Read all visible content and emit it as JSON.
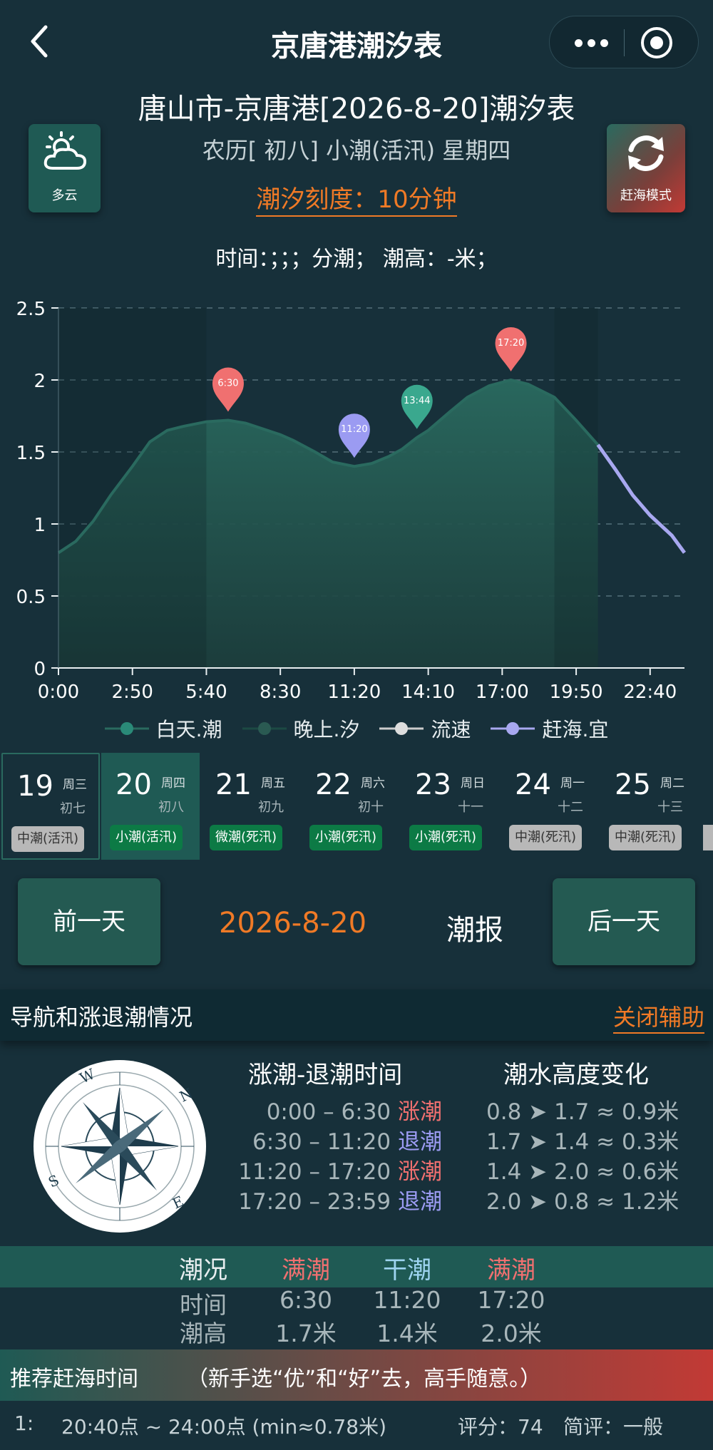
{
  "nav": {
    "title": "京唐港潮汐表"
  },
  "header": {
    "title": "唐山市-京唐港[2026-8-20]潮汐表",
    "subtitle": "农历[ 初八] 小潮(活汛) 星期四",
    "scale": "潮汐刻度：10分钟",
    "readout": "时间：；；；分潮；  潮高：-米；"
  },
  "weather": {
    "label": "多云",
    "icon": "cloud-sun-icon"
  },
  "sea_mode": {
    "label": "赶海模式",
    "icon": "refresh-icon"
  },
  "chart_data": {
    "type": "area",
    "x": [
      "0:00",
      "0:40",
      "1:20",
      "2:00",
      "2:50",
      "3:30",
      "4:10",
      "4:50",
      "5:40",
      "6:30",
      "7:10",
      "8:00",
      "8:30",
      "9:00",
      "9:50",
      "10:30",
      "11:20",
      "12:00",
      "12:40",
      "13:10",
      "13:44",
      "14:10",
      "15:00",
      "15:40",
      "16:30",
      "17:20",
      "18:00",
      "19:00",
      "19:50",
      "20:40",
      "21:20",
      "22:00",
      "22:40",
      "23:30",
      "23:59"
    ],
    "series": [
      {
        "name": "白天.潮",
        "values": [
          0.8,
          0.88,
          1.02,
          1.2,
          1.4,
          1.57,
          1.65,
          1.68,
          1.71,
          1.72,
          1.7,
          1.65,
          1.62,
          1.58,
          1.5,
          1.43,
          1.4,
          1.42,
          1.47,
          1.52,
          1.6,
          1.65,
          1.78,
          1.88,
          1.96,
          2.0,
          1.97,
          1.88,
          1.72,
          1.55,
          1.38,
          1.2,
          1.06,
          0.92,
          0.8
        ]
      }
    ],
    "segments": {
      "night_end": "5:40",
      "night_start": "19:00",
      "sea_start": "20:40"
    },
    "markers": [
      {
        "label": "6:30",
        "x": "6:30",
        "y": 1.72,
        "color": "#f07070"
      },
      {
        "label": "11:20",
        "x": "11:20",
        "y": 1.4,
        "color": "#9b9bf2"
      },
      {
        "label": "13:44",
        "x": "13:44",
        "y": 1.6,
        "color": "#3aa88e"
      },
      {
        "label": "17:20",
        "x": "17:20",
        "y": 2.0,
        "color": "#f07070"
      }
    ],
    "xticks": [
      "0:00",
      "2:50",
      "5:40",
      "8:30",
      "11:20",
      "14:10",
      "17:00",
      "19:50",
      "22:40"
    ],
    "yticks": [
      "0",
      "0.5",
      "1",
      "1.5",
      "2",
      "2.5"
    ],
    "ylim": [
      0,
      2.5
    ],
    "grid": true,
    "legend": [
      "白天.潮",
      "晚上.汐",
      "流速",
      "赶海.宜"
    ],
    "legend_placement": "bottom",
    "colors": {
      "day": "#2a6a5f",
      "night": "#1c4a44",
      "flow": "#cccccc",
      "sea": "#a8a8f0"
    }
  },
  "days": [
    {
      "num": "19",
      "week": "周三",
      "lunar": "初七",
      "tide": "中潮(活汛)",
      "badge": "grey"
    },
    {
      "num": "20",
      "week": "周四",
      "lunar": "初八",
      "tide": "小潮(活汛)",
      "badge": "green"
    },
    {
      "num": "21",
      "week": "周五",
      "lunar": "初九",
      "tide": "微潮(死汛)",
      "badge": "green"
    },
    {
      "num": "22",
      "week": "周六",
      "lunar": "初十",
      "tide": "小潮(死汛)",
      "badge": "green"
    },
    {
      "num": "23",
      "week": "周日",
      "lunar": "十一",
      "tide": "小潮(死汛)",
      "badge": "green"
    },
    {
      "num": "24",
      "week": "周一",
      "lunar": "十二",
      "tide": "中潮(死汛)",
      "badge": "grey"
    },
    {
      "num": "25",
      "week": "周二",
      "lunar": "十三",
      "tide": "中潮(死汛)",
      "badge": "grey"
    }
  ],
  "controls": {
    "prev": "前一天",
    "date": "2026-8-20",
    "report": "潮报",
    "next": "后一天"
  },
  "section": {
    "title": "导航和涨退潮情况",
    "close": "关闭辅助"
  },
  "tide_times": {
    "header": "涨潮-退潮时间",
    "rows": [
      {
        "range": "0:00 – 6:30",
        "state": "涨潮",
        "color": "red"
      },
      {
        "range": "6:30 – 11:20",
        "state": "退潮",
        "color": "blue"
      },
      {
        "range": "11:20 – 17:20",
        "state": "涨潮",
        "color": "red"
      },
      {
        "range": "17:20 – 23:59",
        "state": "退潮",
        "color": "blue"
      }
    ]
  },
  "height_change": {
    "header": "潮水高度变化",
    "rows": [
      "0.8 ➤ 1.7 ≈ 0.9米",
      "1.7 ➤ 1.4 ≈ 0.3米",
      "1.4 ➤ 2.0 ≈ 0.6米",
      "2.0 ➤ 0.8 ≈ 1.2米"
    ]
  },
  "status": {
    "header": [
      "潮况",
      "满潮",
      "干潮",
      "满潮"
    ],
    "time_label": "时间",
    "times": [
      "6:30",
      "11:20",
      "17:20"
    ],
    "height_label": "潮高",
    "heights": [
      "1.7米",
      "1.4米",
      "2.0米"
    ]
  },
  "recommend": {
    "title": "推荐赶海时间",
    "hint": "（新手选“优”和“好”去，高手随意。）",
    "items": [
      {
        "idx": "1:",
        "time": "20:40点 ~ 24:00点 (min≈0.78米)",
        "score": "评分：74",
        "review": "简评：一般"
      }
    ]
  }
}
